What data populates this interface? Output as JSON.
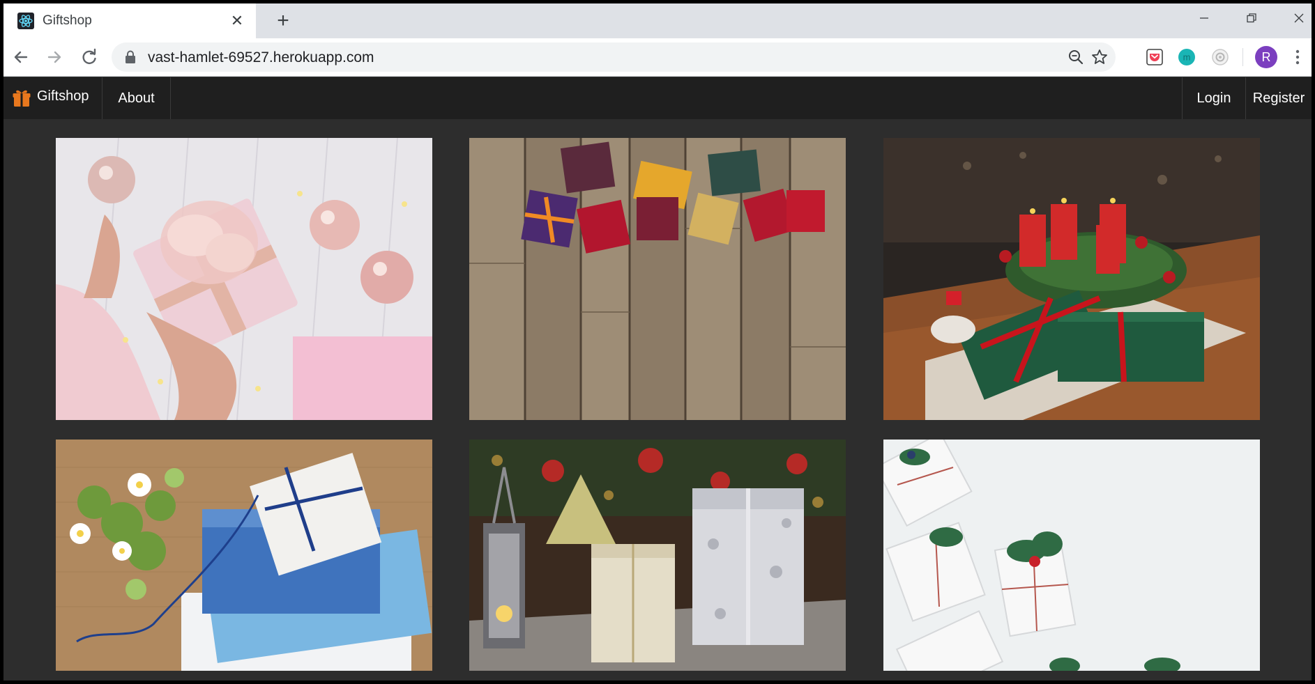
{
  "browser": {
    "tab": {
      "title": "Giftshop",
      "favicon": "react-atom-icon",
      "close_icon": "close-icon"
    },
    "new_tab_icon": "plus-icon",
    "window_controls": [
      "minimize-icon",
      "restore-icon",
      "close-icon"
    ],
    "url": "vast-hamlet-69527.herokuapp.com",
    "avatar_letter": "R",
    "extensions": [
      "pocket-extension-icon",
      "teal-m-extension-icon",
      "camera-extension-icon"
    ]
  },
  "site": {
    "brand": "Giftshop",
    "nav": {
      "about": "About",
      "login": "Login",
      "register": "Register"
    },
    "accent": "#e8781e"
  },
  "gallery": {
    "items": [
      {
        "name": "pink-gift-with-ornaments-image"
      },
      {
        "name": "ring-boxes-on-wood-image"
      },
      {
        "name": "advent-wreath-with-gifts-image"
      },
      {
        "name": "blue-gift-stack-with-flowers-image"
      },
      {
        "name": "silver-gifts-with-lantern-image"
      },
      {
        "name": "white-gifts-with-pine-image"
      }
    ]
  }
}
